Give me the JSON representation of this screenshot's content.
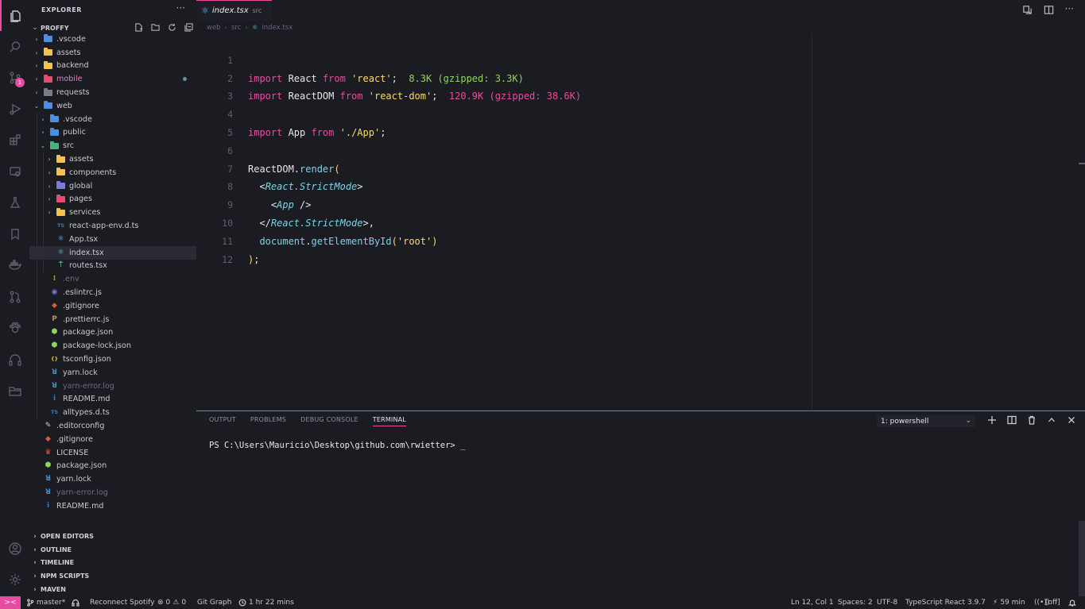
{
  "colors": {
    "accent": "#e64ca0",
    "background": "#1b1b22",
    "keyword": "#e64ca0",
    "string": "#ffd866",
    "class": "#7dd3e8",
    "size_small": "#8fd45b"
  },
  "activity": {
    "scm_badge": "1"
  },
  "explorer": {
    "title": "EXPLORER",
    "more": "···",
    "project": "PROFFY",
    "tree": [
      {
        "label": ".vscode",
        "depth": 1,
        "type": "folder",
        "color": "#4a8fe0",
        "chev": "›"
      },
      {
        "label": "assets",
        "depth": 1,
        "type": "folder",
        "color": "#f3c14c",
        "chev": "›"
      },
      {
        "label": "backend",
        "depth": 1,
        "type": "folder",
        "color": "#f3c14c",
        "chev": "›"
      },
      {
        "label": "mobile",
        "depth": 1,
        "type": "folder",
        "color": "#e64c6c",
        "chev": "›",
        "modified": true,
        "style": "pink"
      },
      {
        "label": "requests",
        "depth": 1,
        "type": "folder",
        "color": "#7a7a88",
        "chev": "›"
      },
      {
        "label": "web",
        "depth": 1,
        "type": "folder",
        "color": "#4a8fe0",
        "chev": "⌄"
      },
      {
        "label": ".vscode",
        "depth": 2,
        "type": "folder",
        "color": "#4a8fe0",
        "chev": "›"
      },
      {
        "label": "public",
        "depth": 2,
        "type": "folder",
        "color": "#4a8fe0",
        "chev": "›"
      },
      {
        "label": "src",
        "depth": 2,
        "type": "folder",
        "color": "#4caf7d",
        "chev": "⌄"
      },
      {
        "label": "assets",
        "depth": 3,
        "type": "folder",
        "color": "#f3c14c",
        "chev": "›"
      },
      {
        "label": "components",
        "depth": 3,
        "type": "folder",
        "color": "#f3c14c",
        "chev": "›"
      },
      {
        "label": "global",
        "depth": 3,
        "type": "folder",
        "color": "#7a7ae0",
        "chev": "›"
      },
      {
        "label": "pages",
        "depth": 3,
        "type": "folder",
        "color": "#e64c6c",
        "chev": "›"
      },
      {
        "label": "services",
        "depth": 3,
        "type": "folder",
        "color": "#f3c14c",
        "chev": "›"
      },
      {
        "label": "react-app-env.d.ts",
        "depth": 3,
        "type": "file",
        "icon": "TS",
        "color": "#3b78c6"
      },
      {
        "label": "App.tsx",
        "depth": 3,
        "type": "file",
        "icon": "⚛",
        "color": "#5ac8e8"
      },
      {
        "label": "index.tsx",
        "depth": 3,
        "type": "file",
        "icon": "⚛",
        "color": "#5ac8e8",
        "selected": true
      },
      {
        "label": "routes.tsx",
        "depth": 3,
        "type": "file",
        "icon": "⍑",
        "color": "#4caf7d"
      },
      {
        "label": ".env",
        "depth": 2,
        "type": "file",
        "icon": "⁞",
        "color": "#e0a030",
        "style": "dim"
      },
      {
        "label": ".eslintrc.js",
        "depth": 2,
        "type": "file",
        "icon": "◉",
        "color": "#7a7ae0"
      },
      {
        "label": ".gitignore",
        "depth": 2,
        "type": "file",
        "icon": "◆",
        "color": "#e8553b"
      },
      {
        "label": ".prettierrc.js",
        "depth": 2,
        "type": "file",
        "icon": "P",
        "color": "#b8945c"
      },
      {
        "label": "package.json",
        "depth": 2,
        "type": "file",
        "icon": "⬢",
        "color": "#8fd45b"
      },
      {
        "label": "package-lock.json",
        "depth": 2,
        "type": "file",
        "icon": "⬢",
        "color": "#8fd45b"
      },
      {
        "label": "tsconfig.json",
        "depth": 2,
        "type": "file",
        "icon": "{}",
        "color": "#f3c14c"
      },
      {
        "label": "yarn.lock",
        "depth": 2,
        "type": "file",
        "icon": "ꓤ",
        "color": "#4a8fc0"
      },
      {
        "label": "yarn-error.log",
        "depth": 2,
        "type": "file",
        "icon": "ꓤ",
        "color": "#4a8fc0",
        "style": "dim"
      },
      {
        "label": "README.md",
        "depth": 2,
        "type": "file",
        "icon": "i",
        "color": "#3b78c6"
      },
      {
        "label": "alltypes.d.ts",
        "depth": 2,
        "type": "file",
        "icon": "TS",
        "color": "#3b78c6"
      },
      {
        "label": ".editorconfig",
        "depth": 1,
        "type": "file",
        "icon": "✎",
        "color": "#d0d0d8"
      },
      {
        "label": ".gitignore",
        "depth": 1,
        "type": "file",
        "icon": "◆",
        "color": "#e8553b"
      },
      {
        "label": "LICENSE",
        "depth": 1,
        "type": "file",
        "icon": "♛",
        "color": "#e8553b"
      },
      {
        "label": "package.json",
        "depth": 1,
        "type": "file",
        "icon": "⬢",
        "color": "#8fd45b"
      },
      {
        "label": "yarn.lock",
        "depth": 1,
        "type": "file",
        "icon": "ꓤ",
        "color": "#4a8fc0"
      },
      {
        "label": "yarn-error.log",
        "depth": 1,
        "type": "file",
        "icon": "ꓤ",
        "color": "#4a8fc0",
        "style": "dim"
      },
      {
        "label": "README.md",
        "depth": 1,
        "type": "file",
        "icon": "i",
        "color": "#3b78c6"
      }
    ],
    "sections": [
      "OPEN EDITORS",
      "OUTLINE",
      "TIMELINE",
      "NPM SCRIPTS",
      "MAVEN"
    ]
  },
  "editor": {
    "tab_name": "index.tsx",
    "tab_desc": "src",
    "breadcrumb": [
      "web",
      "src",
      "index.tsx"
    ],
    "line_numbers": [
      "1",
      "2",
      "3",
      "4",
      "5",
      "6",
      "7",
      "8",
      "9",
      "10",
      "11",
      "12"
    ],
    "code": {
      "l1": {
        "kw": "import",
        "name": " React ",
        "kw2": "from",
        "str": " 'react'",
        "semi": ";",
        "size": "  8.3K (gzipped: 3.3K)"
      },
      "l2": {
        "kw": "import",
        "name": " ReactDOM ",
        "kw2": "from",
        "str": " 'react-dom'",
        "semi": ";",
        "size": "  120.9K (gzipped: 38.6K)"
      },
      "l4": {
        "kw": "import",
        "name": " App ",
        "kw2": "from",
        "str": " './App'",
        "semi": ";"
      },
      "l6": {
        "obj": "ReactDOM",
        "dot": ".",
        "fn": "render",
        "paren": "("
      },
      "l7": {
        "open": "  <",
        "cls": "React.StrictMode",
        "close": ">"
      },
      "l8": {
        "open": "    <",
        "cls": "App",
        "close": " />"
      },
      "l9": {
        "open": "  </",
        "cls": "React.StrictMode",
        "close": ">,"
      },
      "l10": {
        "obj": "  document",
        "dot": ".",
        "fn": "getElementById",
        "paren_open": "(",
        "str": "'root'",
        "paren_close": ")"
      },
      "l11": {
        "paren": ")",
        "semi": ";"
      }
    }
  },
  "panel": {
    "tabs": [
      "OUTPUT",
      "PROBLEMS",
      "DEBUG CONSOLE",
      "TERMINAL"
    ],
    "active_tab": "TERMINAL",
    "terminal_select": "1: powershell",
    "terminal_text": "PS C:\\Users\\Mauricio\\Desktop\\github.com\\rwietter> _"
  },
  "status": {
    "remote": "><",
    "branch": "master*",
    "spotify": "Reconnect Spotify",
    "errors": "0",
    "warnings": "0",
    "git_graph": "Git Graph",
    "timer": "1 hr 22 mins",
    "position": "Ln 12, Col 1",
    "spaces": "Spaces: 2",
    "encoding": "UTF-8",
    "language": "TypeScript React",
    "version": "3.9.7",
    "time": "59 min",
    "toggle": "[off]"
  }
}
